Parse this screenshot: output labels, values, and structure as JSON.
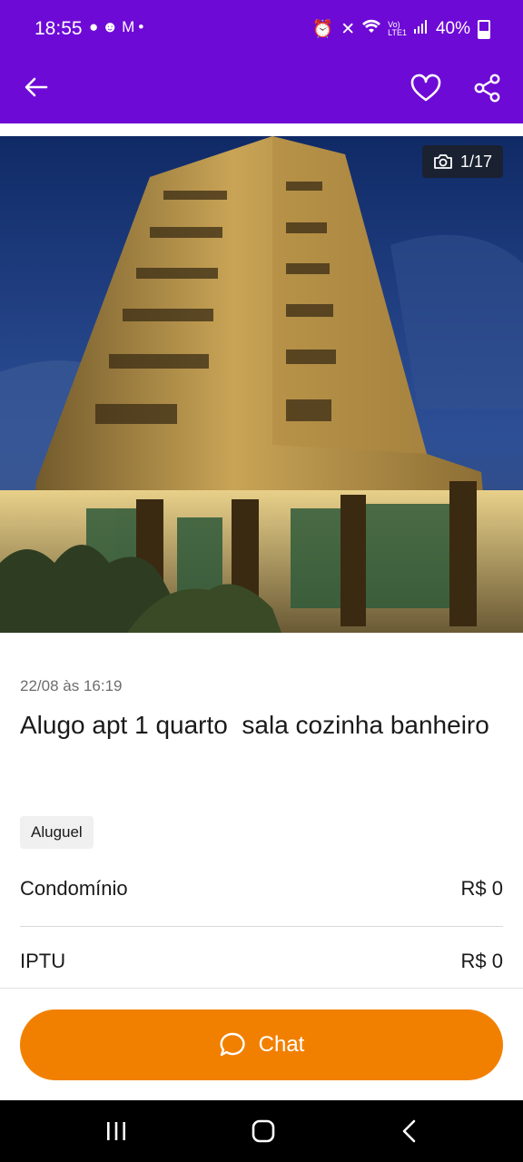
{
  "status_bar": {
    "time": "18:55",
    "notification_icons": [
      "chat-bubble-icon",
      "face-icon",
      "mail-icon",
      "dot-icon"
    ],
    "system_icons": [
      "alarm-icon",
      "mute-icon",
      "wifi-icon",
      "volte-icon",
      "signal-icon"
    ],
    "battery": "40%"
  },
  "top_bar": {
    "back_icon": "arrow-left-icon",
    "favorite_icon": "heart-icon",
    "share_icon": "share-icon",
    "background_color": "#6e0ad6"
  },
  "gallery": {
    "counter": "1/17",
    "counter_icon": "camera-icon"
  },
  "listing": {
    "date": "22/08 às 16:19",
    "title": "Alugo apt 1 quarto  sala cozinha banheiro",
    "tag": "Aluguel",
    "details": [
      {
        "label": "Condomínio",
        "value": "R$ 0"
      },
      {
        "label": "IPTU",
        "value": "R$ 0"
      }
    ]
  },
  "chat_button": {
    "label": "Chat",
    "icon": "chat-bubble-icon",
    "color": "#f28000"
  },
  "nav_bar": {
    "items": [
      "recent-apps-icon",
      "home-icon",
      "back-icon"
    ]
  }
}
